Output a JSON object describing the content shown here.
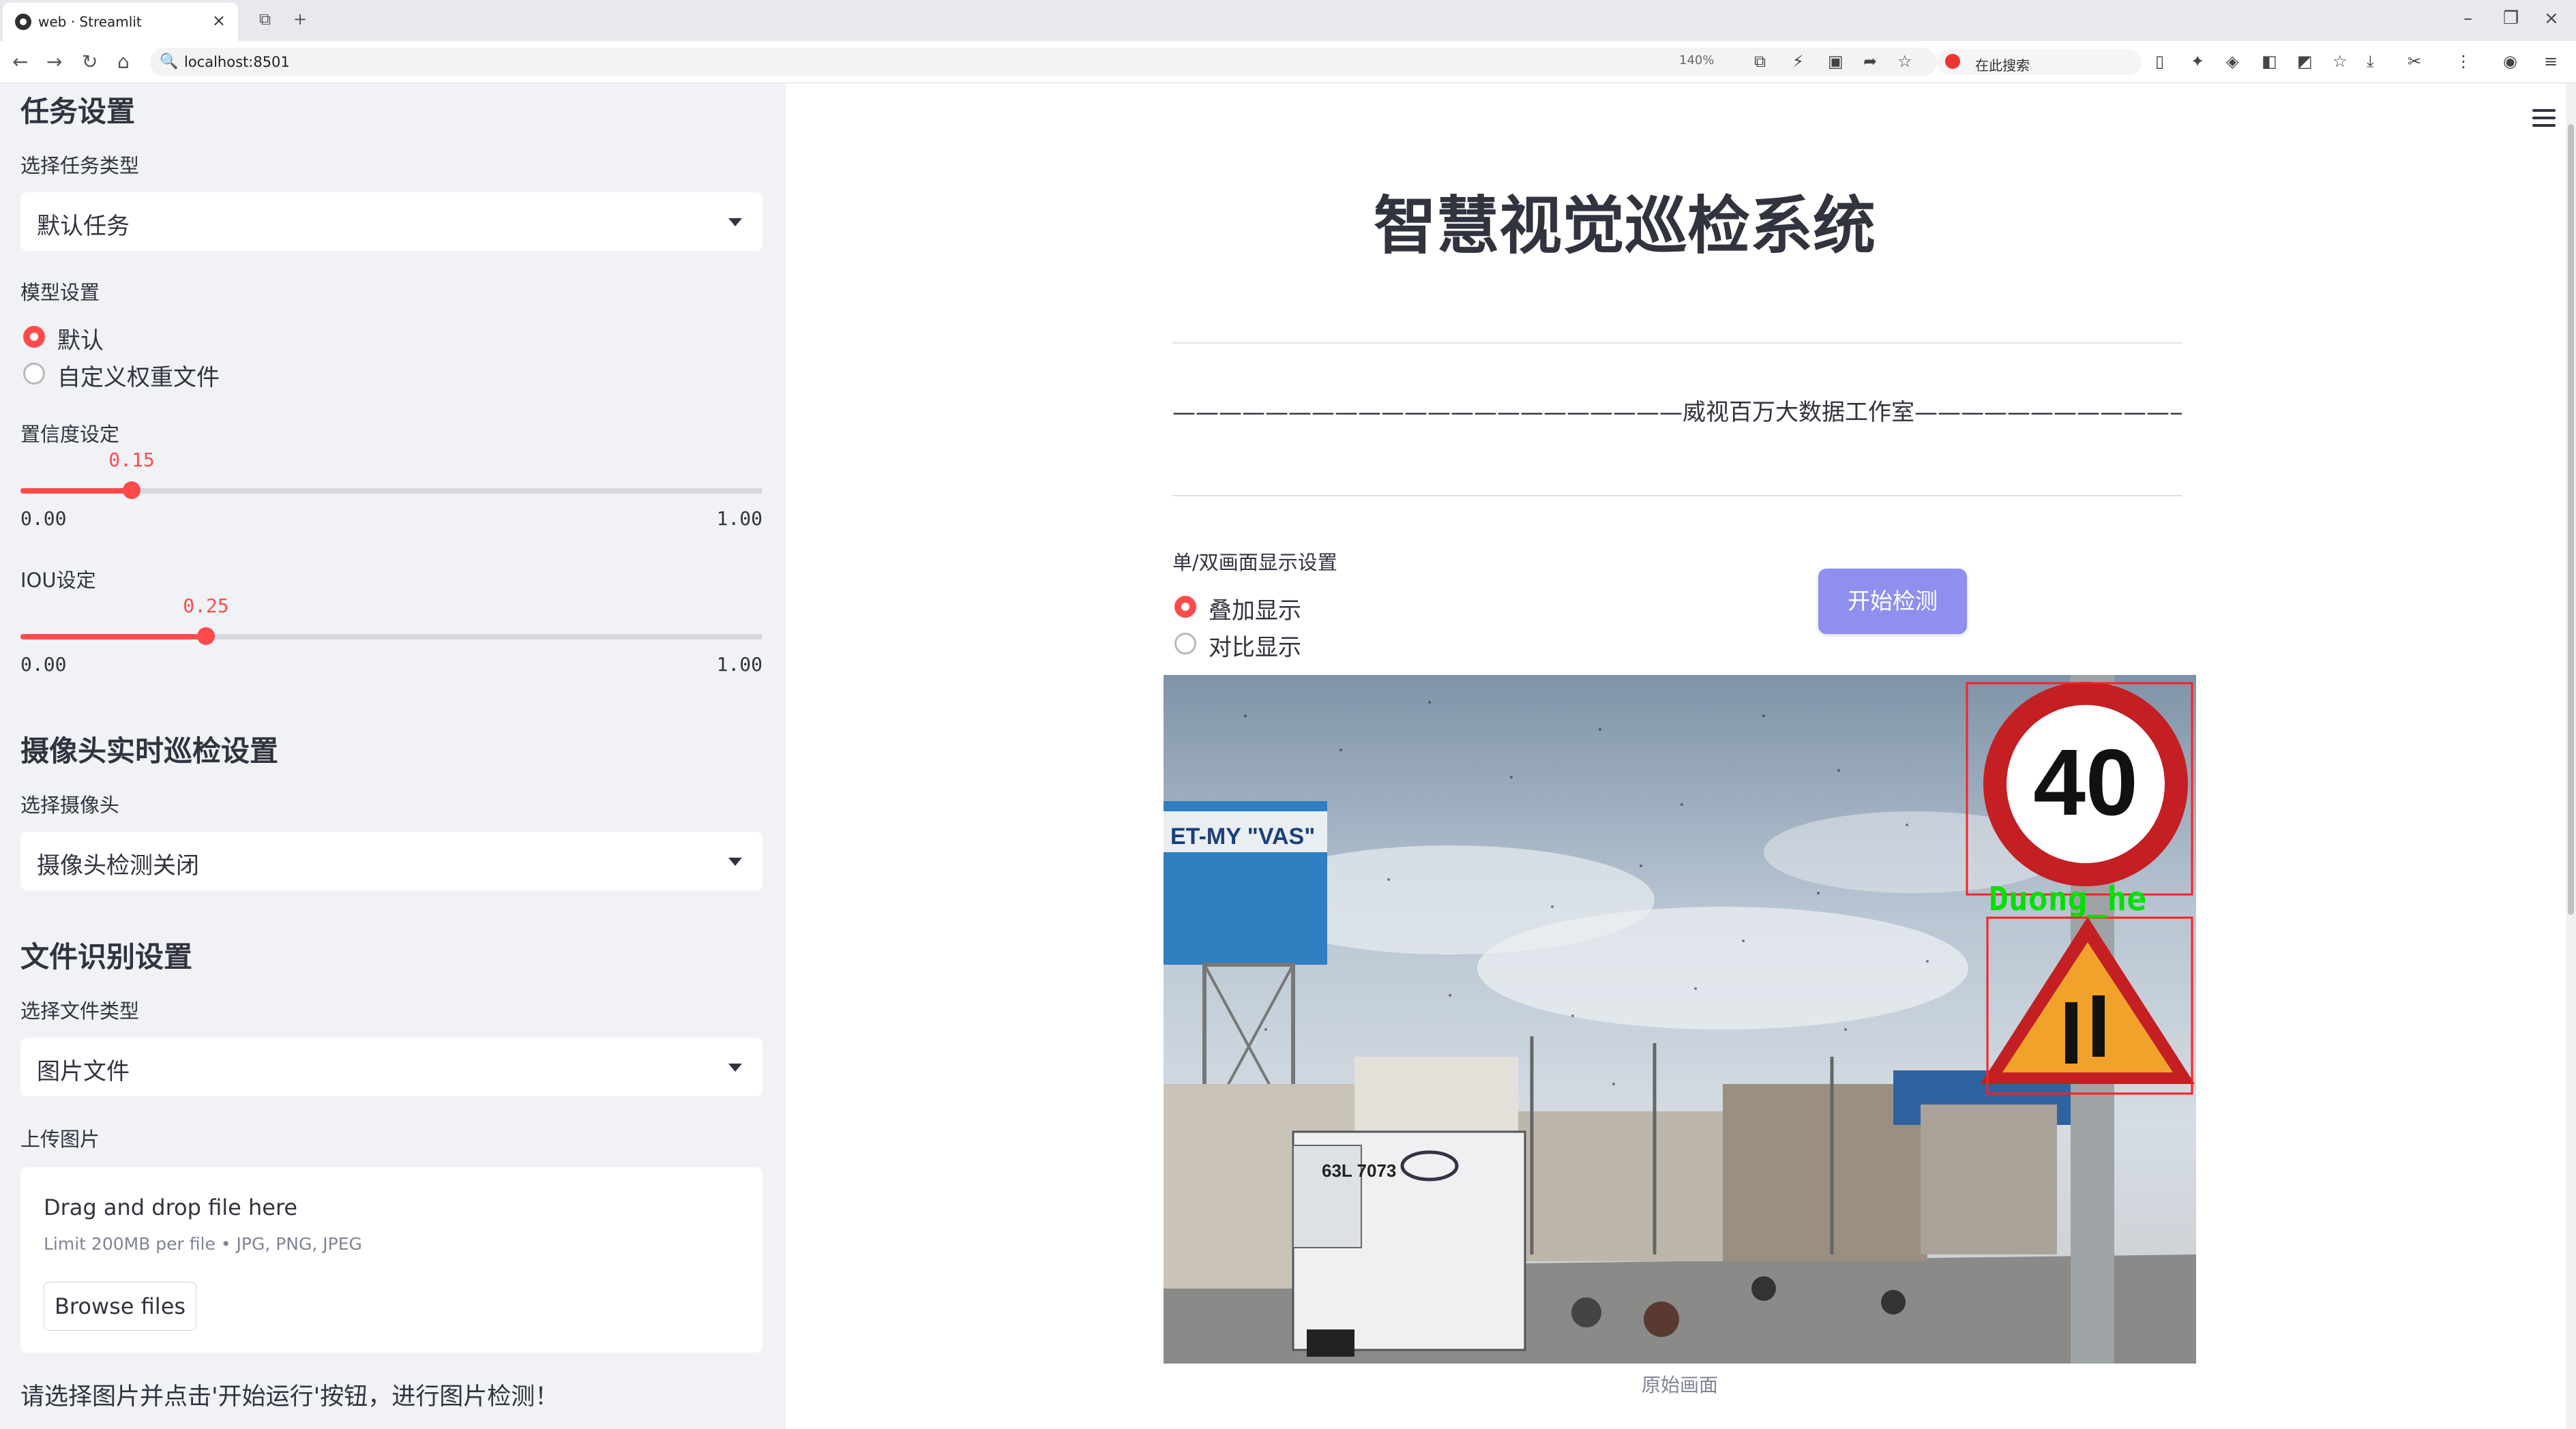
{
  "browser": {
    "tab_title": "web · Streamlit",
    "url": "localhost:8501",
    "zoom": "140%",
    "search_placeholder": "在此搜索"
  },
  "sidebar": {
    "task_section": "任务设置",
    "task_type_label": "选择任务类型",
    "task_type_value": "默认任务",
    "model_label": "模型设置",
    "model_options": [
      "默认",
      "自定义权重文件"
    ],
    "model_selected": "默认",
    "confidence": {
      "label": "置信度设定",
      "value": "0.15",
      "min": "0.00",
      "max": "1.00",
      "fraction": 0.15
    },
    "iou": {
      "label": "IOU设定",
      "value": "0.25",
      "min": "0.00",
      "max": "1.00",
      "fraction": 0.25
    },
    "camera_section": "摄像头实时巡检设置",
    "camera_label": "选择摄像头",
    "camera_value": "摄像头检测关闭",
    "file_section": "文件识别设置",
    "file_type_label": "选择文件类型",
    "file_type_value": "图片文件",
    "upload_label": "上传图片",
    "upload_title": "Drag and drop file here",
    "upload_limit": "Limit 200MB per file • JPG, PNG, JPEG",
    "browse_button": "Browse files",
    "note": "请选择图片并点击'开始运行'按钮，进行图片检测！"
  },
  "main": {
    "title": "智慧视觉巡检系统",
    "studio_line": "——————————————————————威视百万大数据工作室————————————————————————",
    "display_label": "单/双画面显示设置",
    "display_options": [
      "叠加显示",
      "对比显示"
    ],
    "display_selected": "叠加显示",
    "start_button": "开始检测",
    "image_caption": "原始画面",
    "detection_label": "Duong_he",
    "speed_sign": "40",
    "truck_plate": "63L 7073",
    "billboard_text": "ET-MY \"VAS\"",
    "colors": {
      "accent": "#ff4b4b",
      "button": "#8f8ff0",
      "box": "#ff2020",
      "label": "#00e000"
    }
  }
}
